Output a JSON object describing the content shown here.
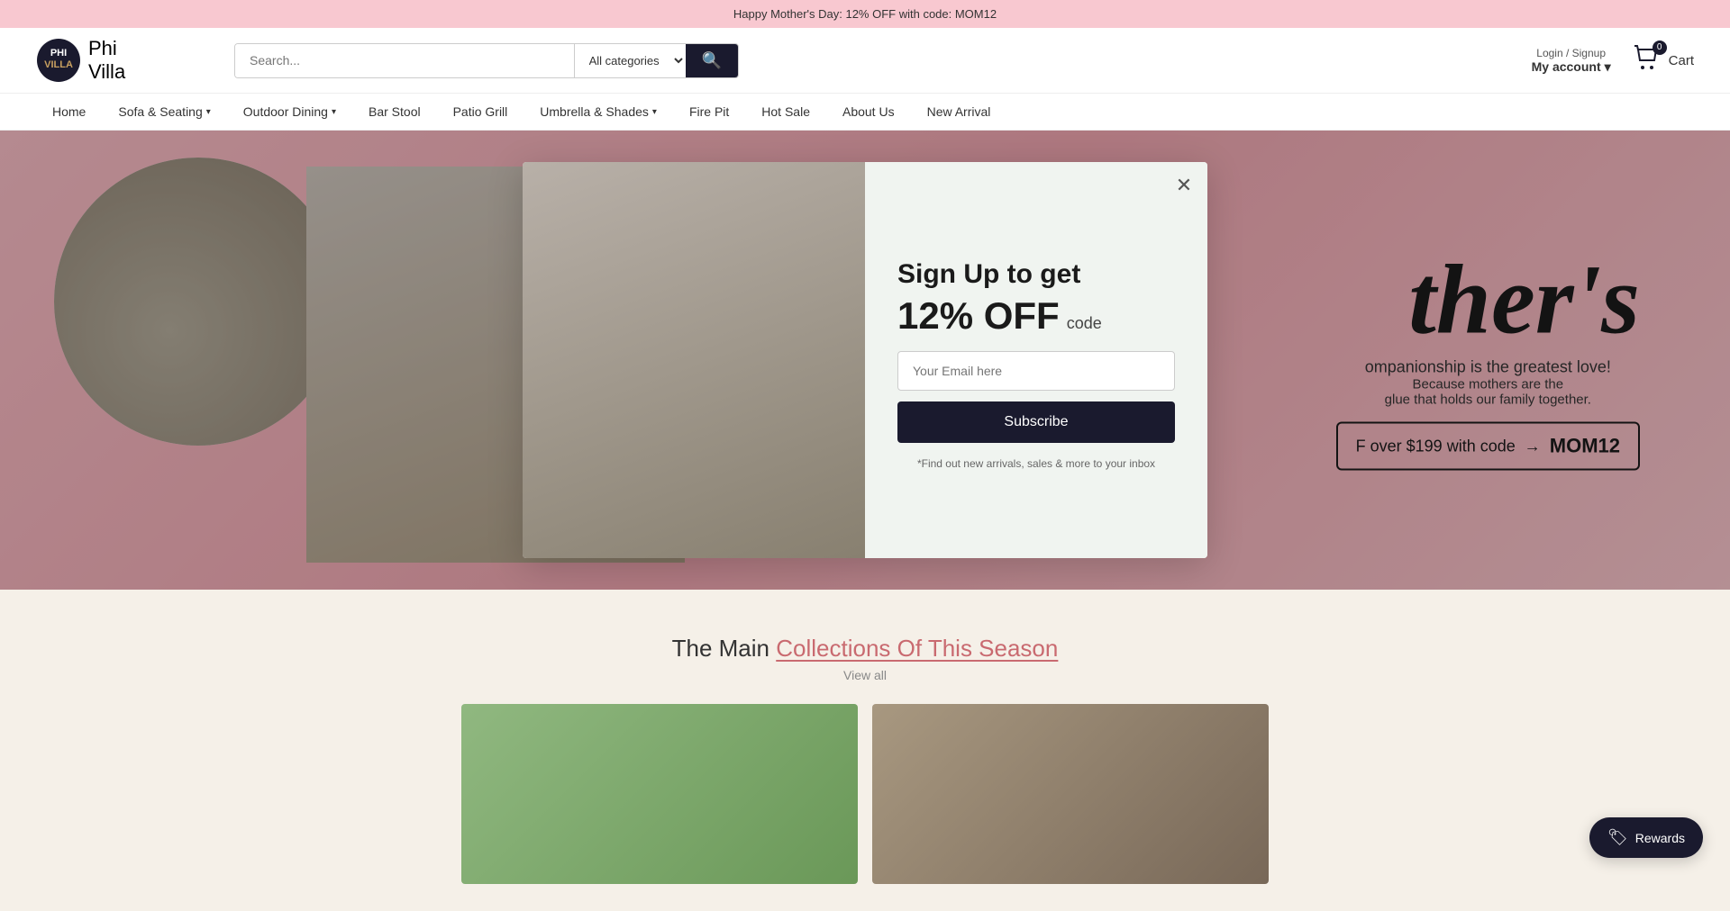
{
  "banner": {
    "text": "Happy Mother's Day: 12% OFF with code: MOM12"
  },
  "header": {
    "logo": {
      "phi": "Phi",
      "villa": "Villa"
    },
    "search": {
      "placeholder": "Search...",
      "category_default": "All categories"
    },
    "login": {
      "top_label": "Login / Signup",
      "account_label": "My account"
    },
    "cart": {
      "count": "0",
      "label": "Cart"
    }
  },
  "nav": {
    "items": [
      {
        "label": "Home",
        "has_dropdown": false
      },
      {
        "label": "Sofa & Seating",
        "has_dropdown": true
      },
      {
        "label": "Outdoor Dining",
        "has_dropdown": true
      },
      {
        "label": "Bar Stool",
        "has_dropdown": false
      },
      {
        "label": "Patio Grill",
        "has_dropdown": false
      },
      {
        "label": "Umbrella & Shades",
        "has_dropdown": true
      },
      {
        "label": "Fire Pit",
        "has_dropdown": false
      },
      {
        "label": "Hot Sale",
        "has_dropdown": false
      },
      {
        "label": "About Us",
        "has_dropdown": false
      },
      {
        "label": "New Arrival",
        "has_dropdown": false
      }
    ]
  },
  "hero": {
    "title_big": "ther's",
    "companionship": "ompanionship is the greatest love!",
    "because": "Because mothers are the",
    "glue": "glue that holds our family together.",
    "promo_prefix": "F over $199 with code",
    "arrow": "→",
    "promo_code": "MOM12"
  },
  "modal": {
    "title_line1": "Sign Up to get",
    "highlight": "12% OFF",
    "code_label": "code",
    "email_placeholder": "Your Email here",
    "subscribe_label": "Subscribe",
    "fine_print": "*Find out new arrivals, sales & more to your inbox"
  },
  "collections": {
    "title_plain": "The Main ",
    "title_em": "Collections Of This Season",
    "subtitle": "View all"
  },
  "rewards": {
    "label": "Rewards"
  }
}
